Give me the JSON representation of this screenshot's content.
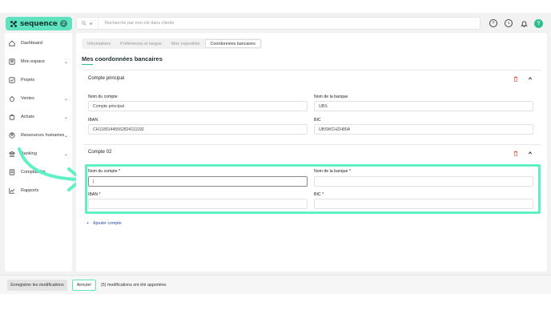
{
  "brand": {
    "name": "sequence",
    "badge": "2"
  },
  "search": {
    "scope_icon": "search-icon",
    "placeholder": "Recherche par mot-clé dans clients"
  },
  "header": {
    "notification_badge": "",
    "avatar_initial": "?"
  },
  "sidebar": {
    "items": [
      {
        "label": "Dashboard",
        "icon": "home-icon",
        "has_chevron": false
      },
      {
        "label": "Mon espace",
        "icon": "user-square-icon",
        "has_chevron": true
      },
      {
        "label": "Projets",
        "icon": "checkbox-icon",
        "has_chevron": false
      },
      {
        "label": "Ventes",
        "icon": "money-bag-icon",
        "has_chevron": true
      },
      {
        "label": "Achats",
        "icon": "shopping-bag-icon",
        "has_chevron": true
      },
      {
        "label": "Ressources humaines",
        "icon": "people-icon",
        "has_chevron": true
      },
      {
        "label": "Banking",
        "icon": "bank-icon",
        "has_chevron": true
      },
      {
        "label": "Comptabilité",
        "icon": "ledger-icon",
        "has_chevron": false
      },
      {
        "label": "Rapports",
        "icon": "chart-icon",
        "has_chevron": false
      }
    ]
  },
  "tabs": [
    {
      "label": "Informations",
      "active": false
    },
    {
      "label": "Préférences et langue",
      "active": false
    },
    {
      "label": "Mon exposition",
      "active": false
    },
    {
      "label": "Coordonnées bancaires",
      "active": true
    }
  ],
  "page_title": "Mes coordonnées bancaires",
  "accounts": [
    {
      "title": "Compte principal",
      "fields": {
        "account_name": {
          "label": "Nom du compte",
          "value": "Compte principal"
        },
        "bank_name": {
          "label": "Nom de la banque",
          "value": "UBS"
        },
        "iban": {
          "label": "IBAN",
          "value": "CH11891445552824111192"
        },
        "bic": {
          "label": "BIC",
          "value": "UBSWCHZH80A"
        }
      }
    },
    {
      "title": "Compte 02",
      "fields": {
        "account_name": {
          "label": "Nom du compte *",
          "value": "|"
        },
        "bank_name": {
          "label": "Nom de la banque *",
          "value": ""
        },
        "iban": {
          "label": "IBAN *",
          "value": ""
        },
        "bic": {
          "label": "BIC *",
          "value": ""
        }
      }
    }
  ],
  "add_account_label": "Ajouter compte",
  "footer": {
    "save_label": "Enregistrer les modifications",
    "cancel_label": "Annuler",
    "status_text": "(5) modifications ont été apportées"
  },
  "colors": {
    "accent": "#5fe3bf",
    "highlight": "#5ff0c5",
    "danger": "#e0533d",
    "link": "#2a4e9e"
  }
}
